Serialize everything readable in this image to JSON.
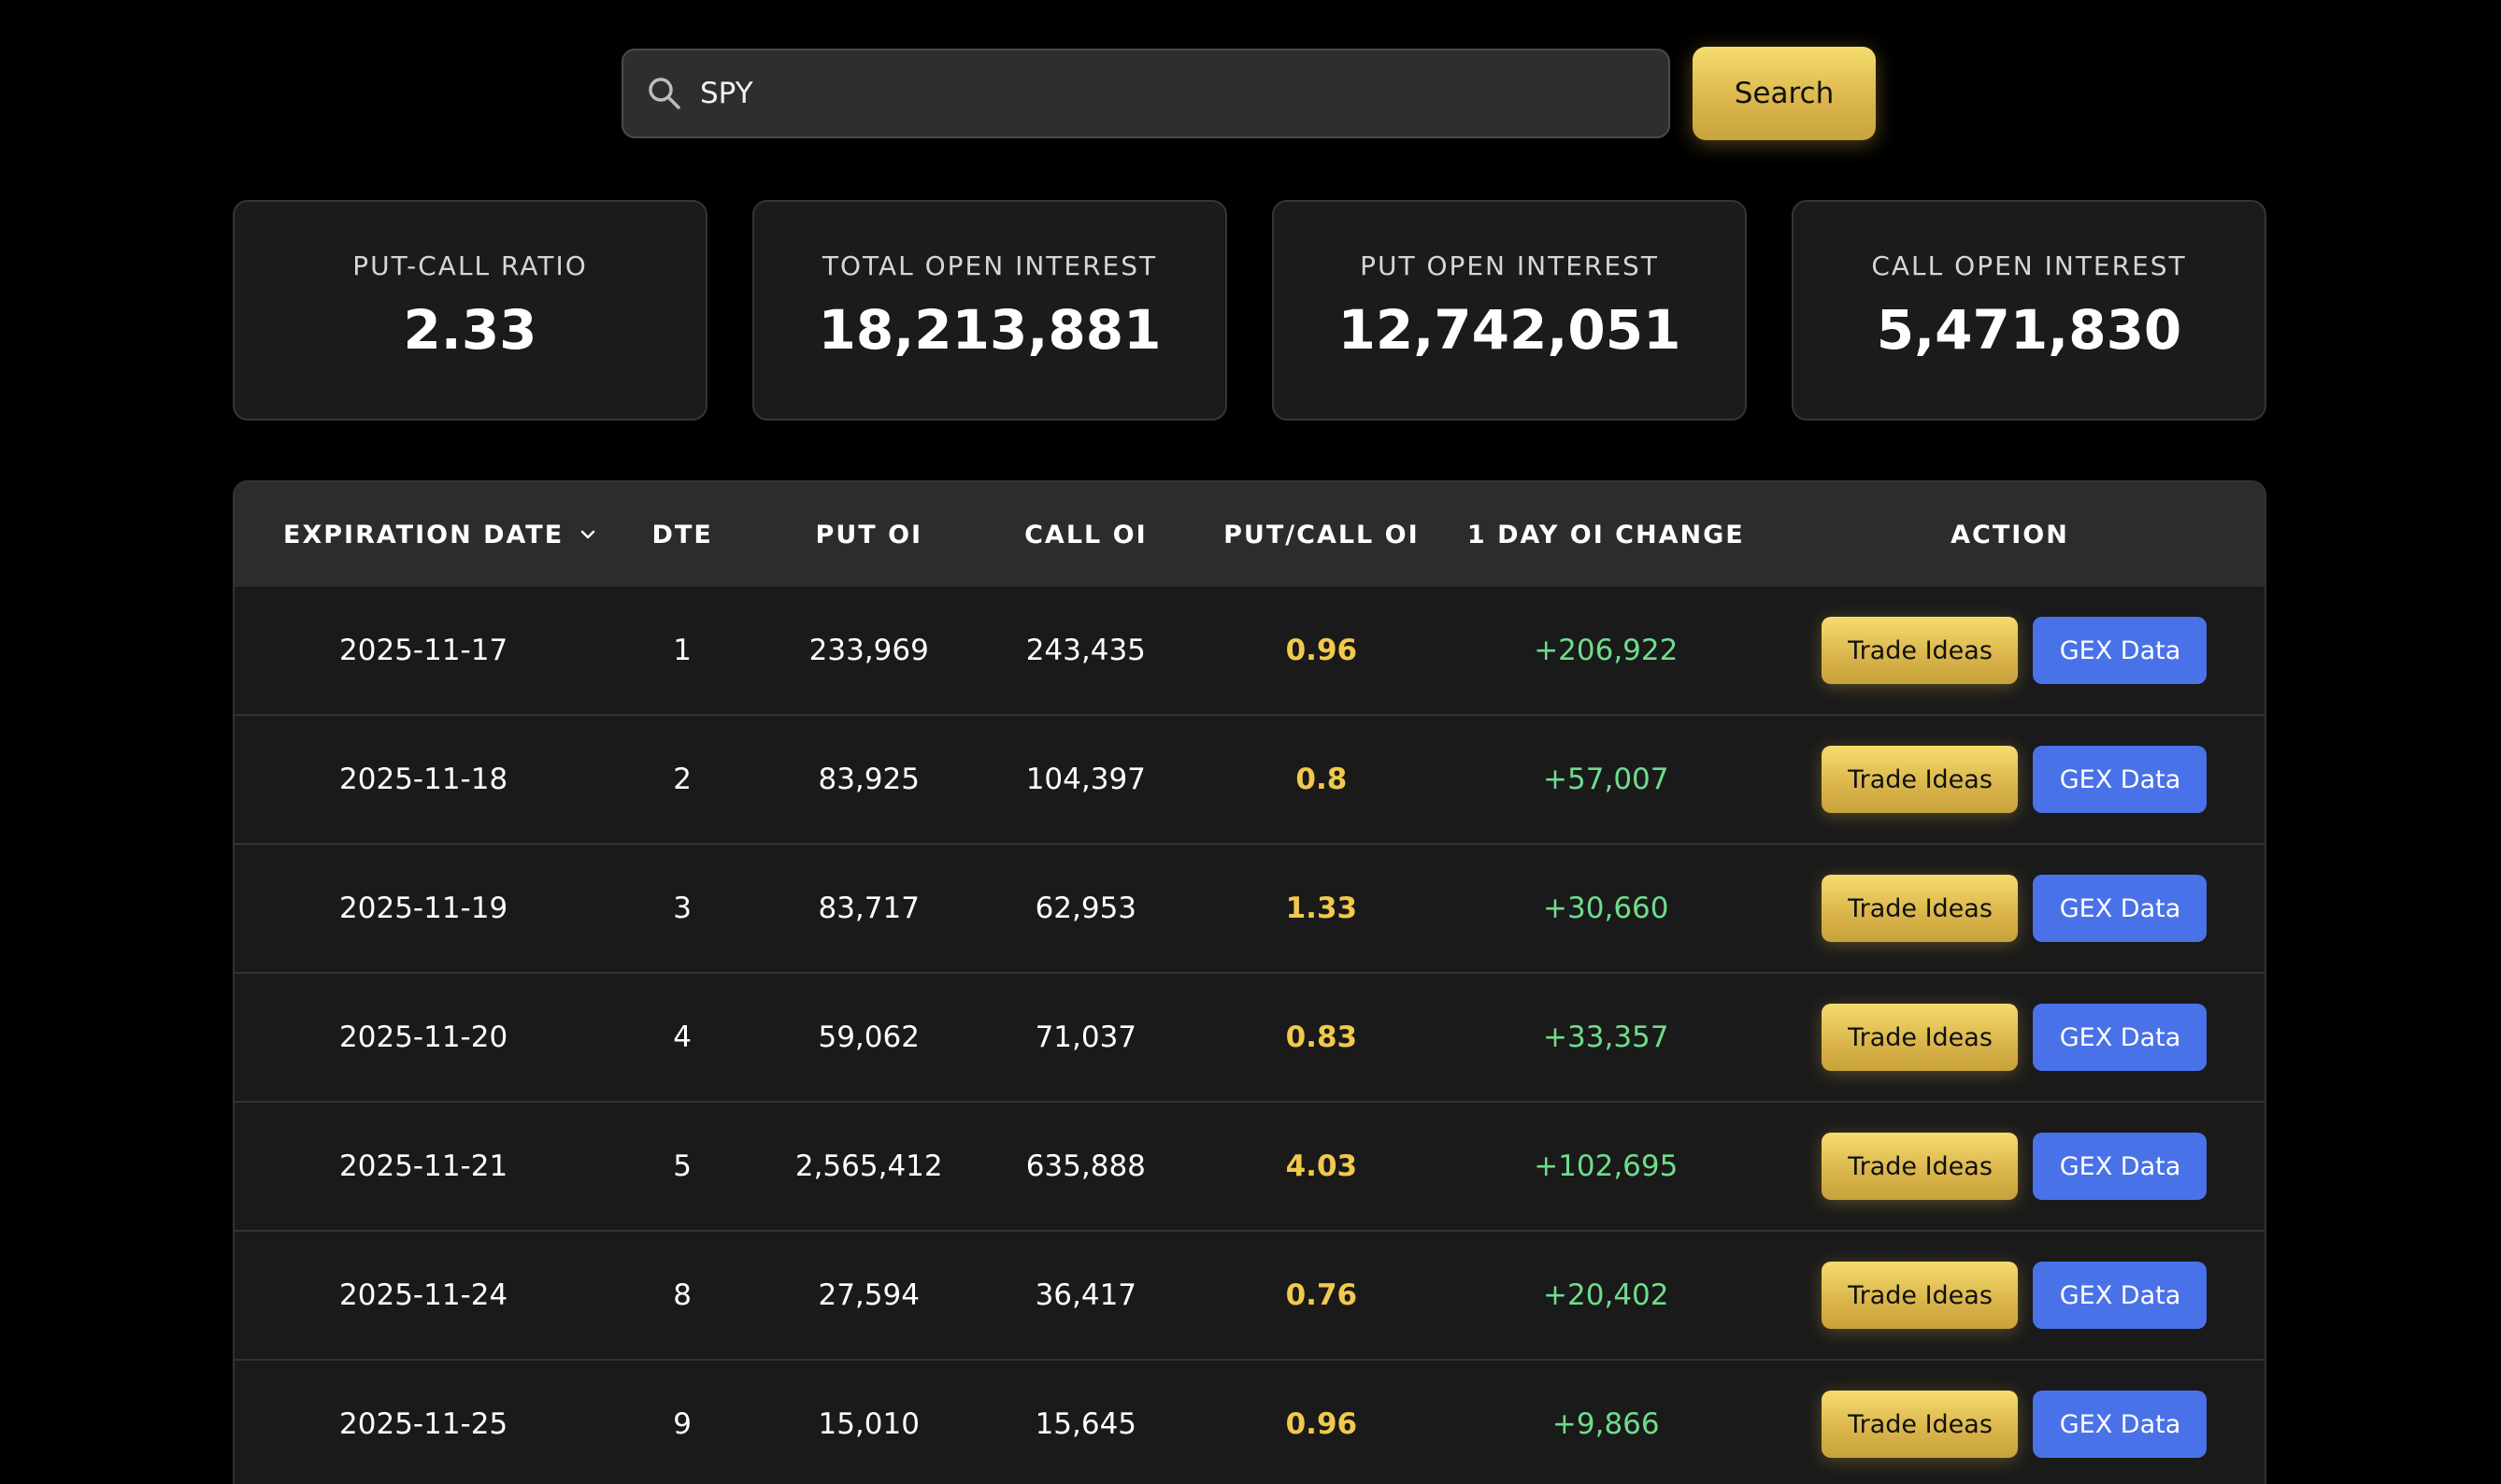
{
  "search": {
    "value": "SPY",
    "button_label": "Search"
  },
  "stats": [
    {
      "label": "PUT-CALL RATIO",
      "value": "2.33"
    },
    {
      "label": "TOTAL OPEN INTEREST",
      "value": "18,213,881"
    },
    {
      "label": "PUT OPEN INTEREST",
      "value": "12,742,051"
    },
    {
      "label": "CALL OPEN INTEREST",
      "value": "5,471,830"
    }
  ],
  "table": {
    "headers": {
      "expiration": "EXPIRATION DATE",
      "dte": "DTE",
      "put_oi": "PUT OI",
      "call_oi": "CALL OI",
      "ratio": "PUT/CALL OI",
      "change": "1 DAY OI CHANGE",
      "action": "ACTION"
    },
    "sort_icon": "chevron-down-icon",
    "action_labels": {
      "trade": "Trade Ideas",
      "gex": "GEX Data"
    },
    "rows": [
      {
        "date": "2025-11-17",
        "dte": "1",
        "put": "233,969",
        "call": "243,435",
        "ratio": "0.96",
        "change": "+206,922"
      },
      {
        "date": "2025-11-18",
        "dte": "2",
        "put": "83,925",
        "call": "104,397",
        "ratio": "0.8",
        "change": "+57,007"
      },
      {
        "date": "2025-11-19",
        "dte": "3",
        "put": "83,717",
        "call": "62,953",
        "ratio": "1.33",
        "change": "+30,660"
      },
      {
        "date": "2025-11-20",
        "dte": "4",
        "put": "59,062",
        "call": "71,037",
        "ratio": "0.83",
        "change": "+33,357"
      },
      {
        "date": "2025-11-21",
        "dte": "5",
        "put": "2,565,412",
        "call": "635,888",
        "ratio": "4.03",
        "change": "+102,695"
      },
      {
        "date": "2025-11-24",
        "dte": "8",
        "put": "27,594",
        "call": "36,417",
        "ratio": "0.76",
        "change": "+20,402"
      },
      {
        "date": "2025-11-25",
        "dte": "9",
        "put": "15,010",
        "call": "15,645",
        "ratio": "0.96",
        "change": "+9,866"
      }
    ]
  },
  "colors": {
    "accent_gold": "#f2c94c",
    "positive_green": "#6fdc8c",
    "gex_blue": "#4a72e8",
    "background": "#000000"
  }
}
